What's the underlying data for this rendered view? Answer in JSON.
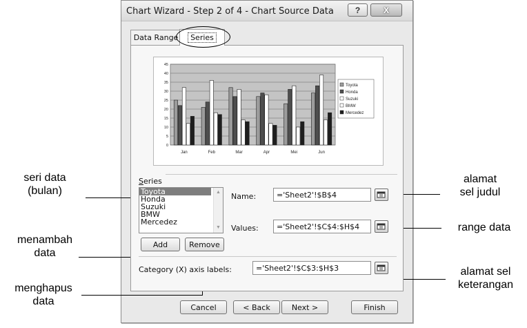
{
  "window": {
    "title": "Chart Wizard - Step 2 of 4 - Chart Source Data",
    "help_glyph": "?",
    "close_glyph": "X"
  },
  "tabs": [
    {
      "label": "Data Range",
      "active": false
    },
    {
      "label": "Series",
      "active": true
    }
  ],
  "chart_data": {
    "type": "bar",
    "categories": [
      "Jan",
      "Feb",
      "Mar",
      "Apr",
      "Mei",
      "Jun"
    ],
    "ylim": [
      0,
      45
    ],
    "yticks": [
      "0",
      "5",
      "10",
      "15",
      "20",
      "25",
      "30",
      "35",
      "40",
      "45"
    ],
    "series": [
      {
        "name": "Toyota",
        "values": [
          25,
          21,
          32,
          27,
          23,
          29
        ],
        "color": "#9c9c9c"
      },
      {
        "name": "Honda",
        "values": [
          22,
          24,
          27,
          29,
          31,
          33
        ],
        "color": "#4e4e4e"
      },
      {
        "name": "Suzuki",
        "values": [
          32,
          36,
          31,
          28,
          33,
          39
        ],
        "color": "#ffffff"
      },
      {
        "name": "BMW",
        "values": [
          12,
          18,
          14,
          12,
          10,
          14
        ],
        "color": "#ffffff"
      },
      {
        "name": "Mercedez",
        "values": [
          16,
          17,
          13,
          11,
          13,
          18
        ],
        "color": "#1e1e1e"
      }
    ],
    "plot_background": "#c4c4c4",
    "grid": true,
    "legend": "right"
  },
  "series_panel": {
    "heading": "Series",
    "items": [
      "Toyota",
      "Honda",
      "Suzuki",
      "BMW",
      "Mercedez"
    ],
    "selected": "Toyota",
    "add_label": "Add",
    "remove_label": "Remove",
    "name_label": "Name:",
    "name_value": "='Sheet2'!$B$4",
    "values_label": "Values:",
    "values_value": "='Sheet2'!$C$4:$H$4"
  },
  "category": {
    "label": "Category (X) axis labels:",
    "value": "='Sheet2'!$C$3:$H$3"
  },
  "footer": {
    "cancel": "Cancel",
    "back": "< Back",
    "next": "Next >",
    "finish": "Finish"
  },
  "annotations": {
    "seri_data_1": "seri data",
    "seri_data_2": "(bulan)",
    "menambah_1": "menambah",
    "menambah_2": "data",
    "menghapus_1": "menghapus",
    "menghapus_2": "data",
    "alamat_judul_1": "alamat",
    "alamat_judul_2": "sel judul",
    "range_data": "range data",
    "alamat_ket_1": "alamat sel",
    "alamat_ket_2": "keterangan"
  }
}
